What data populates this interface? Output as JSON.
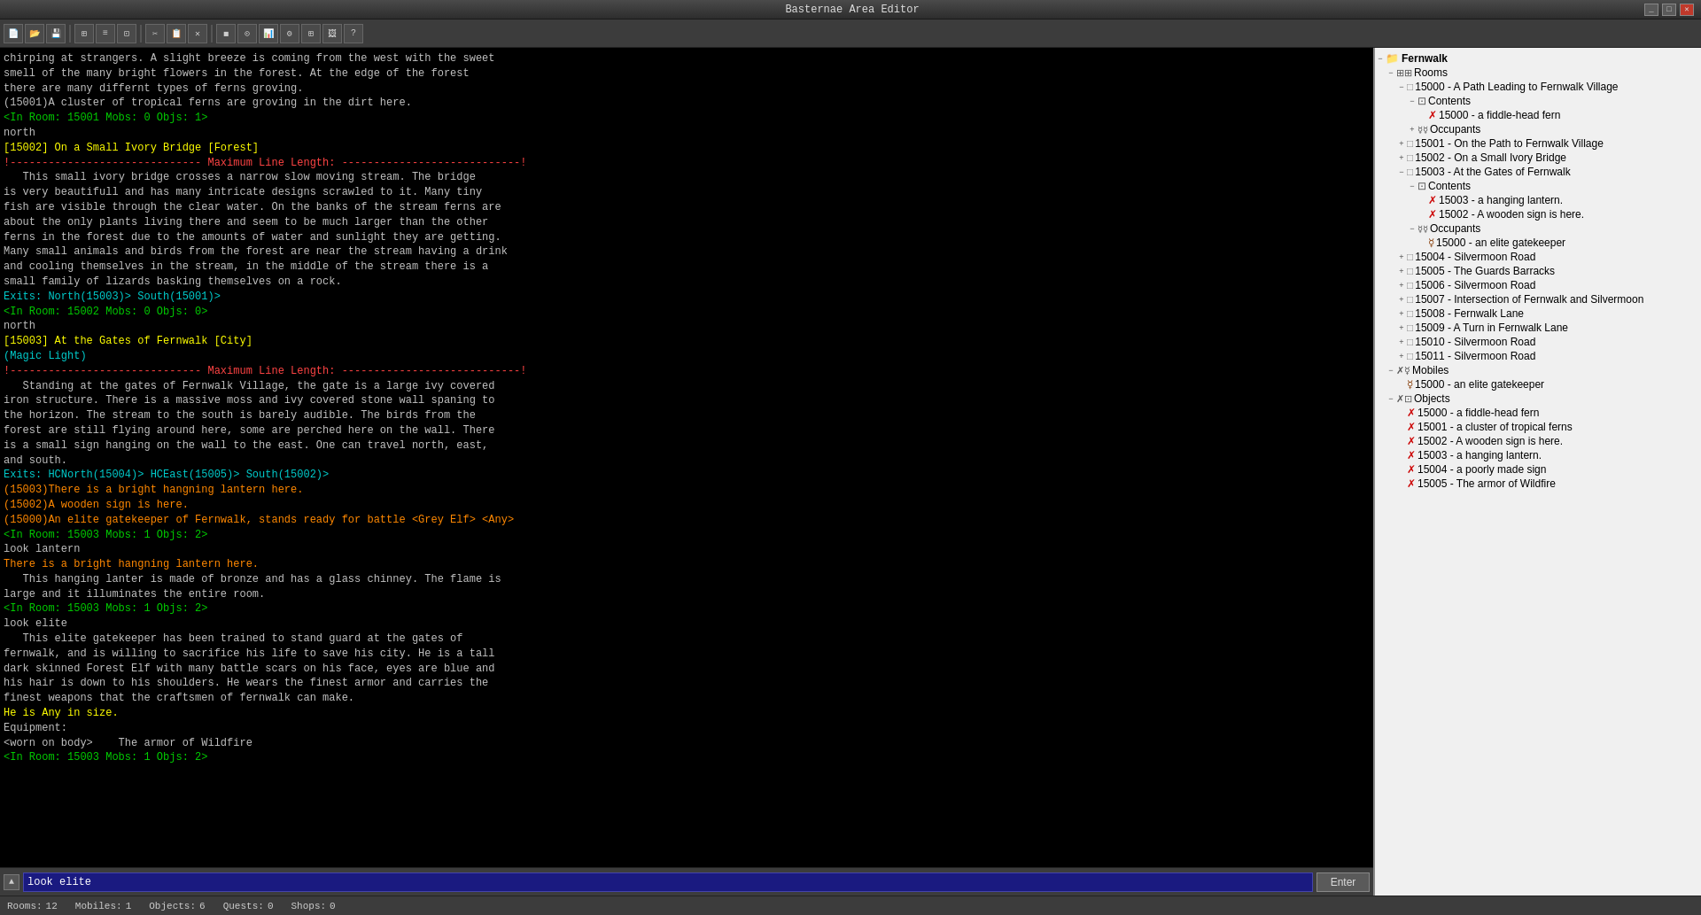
{
  "titleBar": {
    "title": "Basternae Area Editor",
    "minimizeLabel": "_",
    "maximizeLabel": "□",
    "closeLabel": "✕"
  },
  "toolbar": {
    "buttons": [
      {
        "name": "new",
        "icon": "📄"
      },
      {
        "name": "open",
        "icon": "📂"
      },
      {
        "name": "save",
        "icon": "💾"
      },
      {
        "name": "sep1",
        "type": "sep"
      },
      {
        "name": "btn4",
        "icon": "⊞"
      },
      {
        "name": "btn5",
        "icon": "≡"
      },
      {
        "name": "btn6",
        "icon": "⊡"
      },
      {
        "name": "sep2",
        "type": "sep"
      },
      {
        "name": "btn7",
        "icon": "✂"
      },
      {
        "name": "btn8",
        "icon": "📋"
      },
      {
        "name": "btn9",
        "icon": "✕"
      },
      {
        "name": "sep3",
        "type": "sep"
      },
      {
        "name": "btn10",
        "icon": "◼"
      },
      {
        "name": "btn11",
        "icon": "⊙"
      },
      {
        "name": "btn12",
        "icon": "📊"
      },
      {
        "name": "btn13",
        "icon": "⚙"
      },
      {
        "name": "btn14",
        "icon": "⊞"
      },
      {
        "name": "btn15",
        "icon": "🖼"
      },
      {
        "name": "btn16",
        "icon": "?"
      }
    ]
  },
  "terminal": {
    "lines": [
      {
        "text": "chirping at strangers. A slight breeze is coming from the west with the sweet",
        "color": "white"
      },
      {
        "text": "smell of the many bright flowers in the forest. At the edge of the forest",
        "color": "white",
        "special": "forest1"
      },
      {
        "text": "there are many differnt types of ferns groving.",
        "color": "white",
        "special": "ferns1"
      },
      {
        "text": "(15001)A cluster of tropical ferns are groving in the dirt here.",
        "color": "white",
        "special": "ferns2"
      },
      {
        "text": "",
        "color": "white"
      },
      {
        "text": "<In Room: 15001 Mobs: 0 Objs: 1>",
        "color": "green"
      },
      {
        "text": "north",
        "color": "white"
      },
      {
        "text": "",
        "color": "white"
      },
      {
        "text": "[15002] On a Small Ivory Bridge [Forest]",
        "color": "yellow"
      },
      {
        "text": "!------------------------------ Maximum Line Length: ----------------------------!",
        "color": "red"
      },
      {
        "text": "   This small ivory bridge crosses a narrow slow moving stream. The bridge",
        "color": "white"
      },
      {
        "text": "is very beautifull and has many intricate designs scrawled to it. Many tiny",
        "color": "white"
      },
      {
        "text": "fish are visible through the clear water. On the banks of the stream ferns are",
        "color": "white"
      },
      {
        "text": "about the only plants living there and seem to be much larger than the other",
        "color": "white"
      },
      {
        "text": "ferns in the forest due to the amounts of water and sunlight they are getting.",
        "color": "white"
      },
      {
        "text": "Many small animals and birds from the forest are near the stream having a drink",
        "color": "white"
      },
      {
        "text": "and cooling themselves in the stream, in the middle of the stream there is a",
        "color": "white"
      },
      {
        "text": "small family of lizards basking themselves on a rock.",
        "color": "white"
      },
      {
        "text": "Exits: North(15003)> South(15001)>",
        "color": "cyan"
      },
      {
        "text": "",
        "color": "white"
      },
      {
        "text": "<In Room: 15002 Mobs: 0 Objs: 0>",
        "color": "green"
      },
      {
        "text": "north",
        "color": "white"
      },
      {
        "text": "",
        "color": "white"
      },
      {
        "text": "[15003] At the Gates of Fernwalk [City]",
        "color": "yellow"
      },
      {
        "text": "(Magic Light)",
        "color": "cyan"
      },
      {
        "text": "!------------------------------ Maximum Line Length: ----------------------------!",
        "color": "red"
      },
      {
        "text": "   Standing at the gates of Fernwalk Village, the gate is a large ivy covered",
        "color": "white"
      },
      {
        "text": "iron structure. There is a massive moss and ivy covered stone wall spaning to",
        "color": "white"
      },
      {
        "text": "the horizon. The stream to the south is barely audible. The birds from the",
        "color": "white"
      },
      {
        "text": "forest are still flying around here, some are perched here on the wall. There",
        "color": "white"
      },
      {
        "text": "is a small sign hanging on the wall to the east. One can travel north, east,",
        "color": "white"
      },
      {
        "text": "and south.",
        "color": "white"
      },
      {
        "text": "Exits: HCNorth(15004)> HCEast(15005)> South(15002)>",
        "color": "cyan"
      },
      {
        "text": "(15003)There is a bright hangning lantern here.",
        "color": "orange"
      },
      {
        "text": "(15002)A wooden sign is here.",
        "color": "orange"
      },
      {
        "text": "(15000)An elite gatekeeper of Fernwalk, stands ready for battle <Grey Elf> <Any>",
        "color": "orange"
      },
      {
        "text": "",
        "color": "white"
      },
      {
        "text": "<In Room: 15003 Mobs: 1 Objs: 2>",
        "color": "green"
      },
      {
        "text": "look lantern",
        "color": "white"
      },
      {
        "text": "There is a bright hangning lantern here.",
        "color": "orange"
      },
      {
        "text": "   This hanging lanter is made of bronze and has a glass chinney. The flame is",
        "color": "white"
      },
      {
        "text": "large and it illuminates the entire room.",
        "color": "white"
      },
      {
        "text": "",
        "color": "white"
      },
      {
        "text": "<In Room: 15003 Mobs: 1 Objs: 2>",
        "color": "green"
      },
      {
        "text": "look elite",
        "color": "white"
      },
      {
        "text": "   This elite gatekeeper has been trained to stand guard at the gates of",
        "color": "white"
      },
      {
        "text": "fernwalk, and is willing to sacrifice his life to save his city. He is a tall",
        "color": "white"
      },
      {
        "text": "dark skinned Forest Elf with many battle scars on his face, eyes are blue and",
        "color": "white"
      },
      {
        "text": "his hair is down to his shoulders. He wears the finest armor and carries the",
        "color": "white"
      },
      {
        "text": "finest weapons that the craftsmen of fernwalk can make.",
        "color": "white"
      },
      {
        "text": "He is Any in size.",
        "color": "yellow"
      },
      {
        "text": "Equipment:",
        "color": "white"
      },
      {
        "text": "<worn on body>    The armor of Wildfire",
        "color": "white"
      },
      {
        "text": "",
        "color": "white"
      },
      {
        "text": "<In Room: 15003 Mobs: 1 Objs: 2>",
        "color": "green"
      }
    ]
  },
  "inputArea": {
    "cmdValue": "look elite",
    "enterLabel": "Enter"
  },
  "statusBar": {
    "rooms": {
      "label": "Rooms:",
      "value": "12"
    },
    "mobiles": {
      "label": "Mobiles:",
      "value": "1"
    },
    "objects": {
      "label": "Objects:",
      "value": "6"
    },
    "quests": {
      "label": "Quests:",
      "value": "0"
    },
    "shops": {
      "label": "Shops:",
      "value": "0"
    }
  },
  "tree": {
    "rootLabel": "Fernwalk",
    "sections": [
      {
        "label": "Rooms",
        "icon": "rooms",
        "expanded": true,
        "items": [
          {
            "id": "15000",
            "label": "15000 - A Path Leading to Fernwalk Village",
            "expanded": true,
            "children": [
              {
                "label": "Contents",
                "icon": "contents",
                "expanded": true,
                "items": [
                  {
                    "id": "15000o",
                    "label": "15000 - a fiddle-head fern",
                    "icon": "obj"
                  }
                ]
              },
              {
                "label": "Occupants",
                "icon": "occupants",
                "expanded": false,
                "items": []
              }
            ]
          },
          {
            "id": "15001",
            "label": "15001 - On the Path to Fernwalk Village",
            "expanded": false
          },
          {
            "id": "15002",
            "label": "15002 - On a Small Ivory Bridge",
            "expanded": false
          },
          {
            "id": "15003",
            "label": "15003 - At the Gates of Fernwalk",
            "expanded": true,
            "children": [
              {
                "label": "Contents",
                "icon": "contents",
                "expanded": true,
                "items": [
                  {
                    "id": "15003o",
                    "label": "15003 - a hanging lantern.",
                    "icon": "obj"
                  },
                  {
                    "id": "15002o",
                    "label": "15002 - A wooden sign is here.",
                    "icon": "obj"
                  }
                ]
              },
              {
                "label": "Occupants",
                "icon": "occupants",
                "expanded": true,
                "items": [
                  {
                    "id": "15000m",
                    "label": "15000 - an elite gatekeeper",
                    "icon": "mob"
                  }
                ]
              }
            ]
          },
          {
            "id": "15004",
            "label": "15004 - Silvermoon Road",
            "expanded": false
          },
          {
            "id": "15005",
            "label": "15005 - The Guards Barracks",
            "expanded": false
          },
          {
            "id": "15006",
            "label": "15006 - Silvermoon Road",
            "expanded": false
          },
          {
            "id": "15007",
            "label": "15007 - Intersection of Fernwalk and Silvermoon",
            "expanded": false
          },
          {
            "id": "15008",
            "label": "15008 - Fernwalk Lane",
            "expanded": false
          },
          {
            "id": "15009",
            "label": "15009 - A Turn in Fernwalk Lane",
            "expanded": false
          },
          {
            "id": "15010",
            "label": "15010 - Silvermoon Road",
            "expanded": false
          },
          {
            "id": "15011",
            "label": "15011 - Silvermoon Road",
            "expanded": false
          }
        ]
      },
      {
        "label": "Mobiles",
        "icon": "mobiles",
        "expanded": true,
        "items": [
          {
            "id": "m15000",
            "label": "15000 - an elite gatekeeper",
            "icon": "mob"
          }
        ]
      },
      {
        "label": "Objects",
        "icon": "objects",
        "expanded": true,
        "items": [
          {
            "id": "o15000",
            "label": "15000 - a fiddle-head fern",
            "icon": "obj"
          },
          {
            "id": "o15001",
            "label": "15001 - a cluster of tropical ferns",
            "icon": "obj"
          },
          {
            "id": "o15002",
            "label": "15002 - A wooden sign is here.",
            "icon": "obj"
          },
          {
            "id": "o15003",
            "label": "15003 - a hanging lantern.",
            "icon": "obj"
          },
          {
            "id": "o15004",
            "label": "15004 - a poorly made sign",
            "icon": "obj"
          },
          {
            "id": "o15005",
            "label": "15005 - The armor of Wildfire",
            "icon": "obj"
          }
        ]
      }
    ]
  }
}
